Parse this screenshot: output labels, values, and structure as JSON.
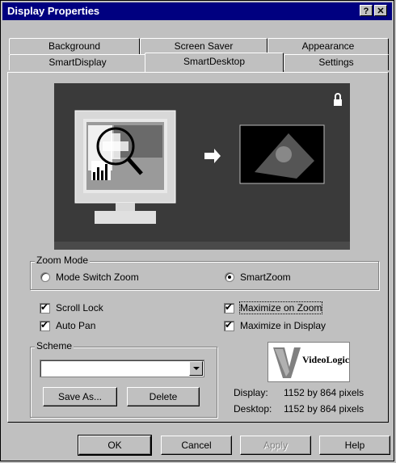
{
  "window": {
    "title": "Display Properties",
    "help_glyph": "?",
    "close_glyph": "✕"
  },
  "tabs": {
    "back_row": [
      "Background",
      "Screen Saver",
      "Appearance"
    ],
    "front_row": [
      "SmartDisplay",
      "SmartDesktop",
      "Settings"
    ],
    "active": "SmartDesktop"
  },
  "zoom_mode": {
    "label": "Zoom Mode",
    "options": [
      {
        "label": "Mode Switch Zoom",
        "selected": false
      },
      {
        "label": "SmartZoom",
        "selected": true
      }
    ]
  },
  "checkboxes": [
    {
      "label": "Scroll Lock",
      "checked": true
    },
    {
      "label": "Auto Pan",
      "checked": true
    },
    {
      "label": "Maximize on Zoom",
      "checked": true
    },
    {
      "label": "Maximize in Display",
      "checked": true
    }
  ],
  "scheme": {
    "label": "Scheme",
    "value": "",
    "save_as": "Save As...",
    "delete": "Delete"
  },
  "logo": {
    "text": "VideoLogic"
  },
  "info": {
    "display_label": "Display:",
    "display_value": "1152 by 864 pixels",
    "desktop_label": "Desktop:",
    "desktop_value": "1152 by 864 pixels"
  },
  "buttons": {
    "ok": "OK",
    "cancel": "Cancel",
    "apply": "Apply",
    "help": "Help"
  },
  "colors": {
    "titlebar": "#000080",
    "face": "#c0c0c0"
  }
}
